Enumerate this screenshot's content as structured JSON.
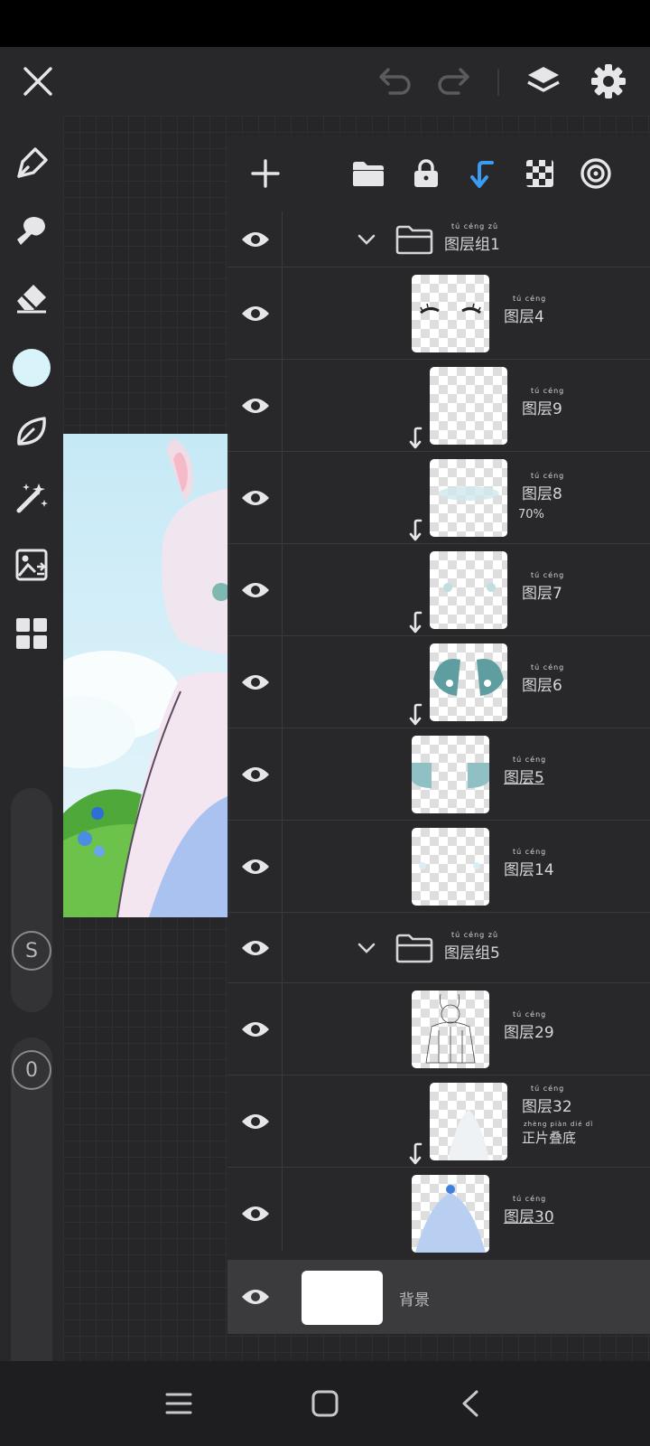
{
  "topbar": {
    "icons": [
      "close-icon",
      "undo-icon",
      "redo-icon",
      "layers-icon",
      "settings-icon"
    ]
  },
  "toolbar": {
    "tools": [
      "brush-icon",
      "smudge-icon",
      "eraser-icon",
      "color-swatch",
      "blur-leaf-icon",
      "magic-wand-icon",
      "image-import-icon",
      "grid-icon"
    ],
    "current_color": "#d9f3fb",
    "size_slider_label": "S",
    "opacity_slider_label": "0"
  },
  "layers_panel": {
    "toolbar_icons": [
      "add-layer-icon",
      "folder-icon",
      "lock-icon",
      "clip-arrow-icon",
      "transparency-icon",
      "blend-icon"
    ],
    "accent": "#3a9bf2",
    "rows": [
      {
        "type": "group",
        "name": "图层组1",
        "ruby": "tú céng zǔ"
      },
      {
        "type": "layer",
        "name": "图层4",
        "ruby": "tú céng"
      },
      {
        "type": "layer",
        "name": "图层9",
        "ruby": "tú céng",
        "clipped": true
      },
      {
        "type": "layer",
        "name": "图层8",
        "ruby": "tú céng",
        "clipped": true,
        "opacity": "70%"
      },
      {
        "type": "layer",
        "name": "图层7",
        "ruby": "tú céng",
        "clipped": true
      },
      {
        "type": "layer",
        "name": "图层6",
        "ruby": "tú céng",
        "clipped": true
      },
      {
        "type": "layer",
        "name": "图层5",
        "ruby": "tú céng",
        "selected_underline": true
      },
      {
        "type": "layer",
        "name": "图层14",
        "ruby": "tú céng"
      },
      {
        "type": "group",
        "name": "图层组5",
        "ruby": "tú céng zǔ"
      },
      {
        "type": "layer",
        "name": "图层29",
        "ruby": "tú céng"
      },
      {
        "type": "layer",
        "name": "图层32",
        "ruby": "tú céng",
        "clipped": true,
        "blend": "正片叠底",
        "blend_ruby": "zhèng piàn dié dǐ"
      },
      {
        "type": "layer",
        "name": "图层30",
        "ruby": "tú céng",
        "selected_underline": true
      }
    ],
    "background_label": "背景"
  },
  "navbar": {
    "icons": [
      "recent-apps-icon",
      "home-icon",
      "back-icon"
    ]
  }
}
